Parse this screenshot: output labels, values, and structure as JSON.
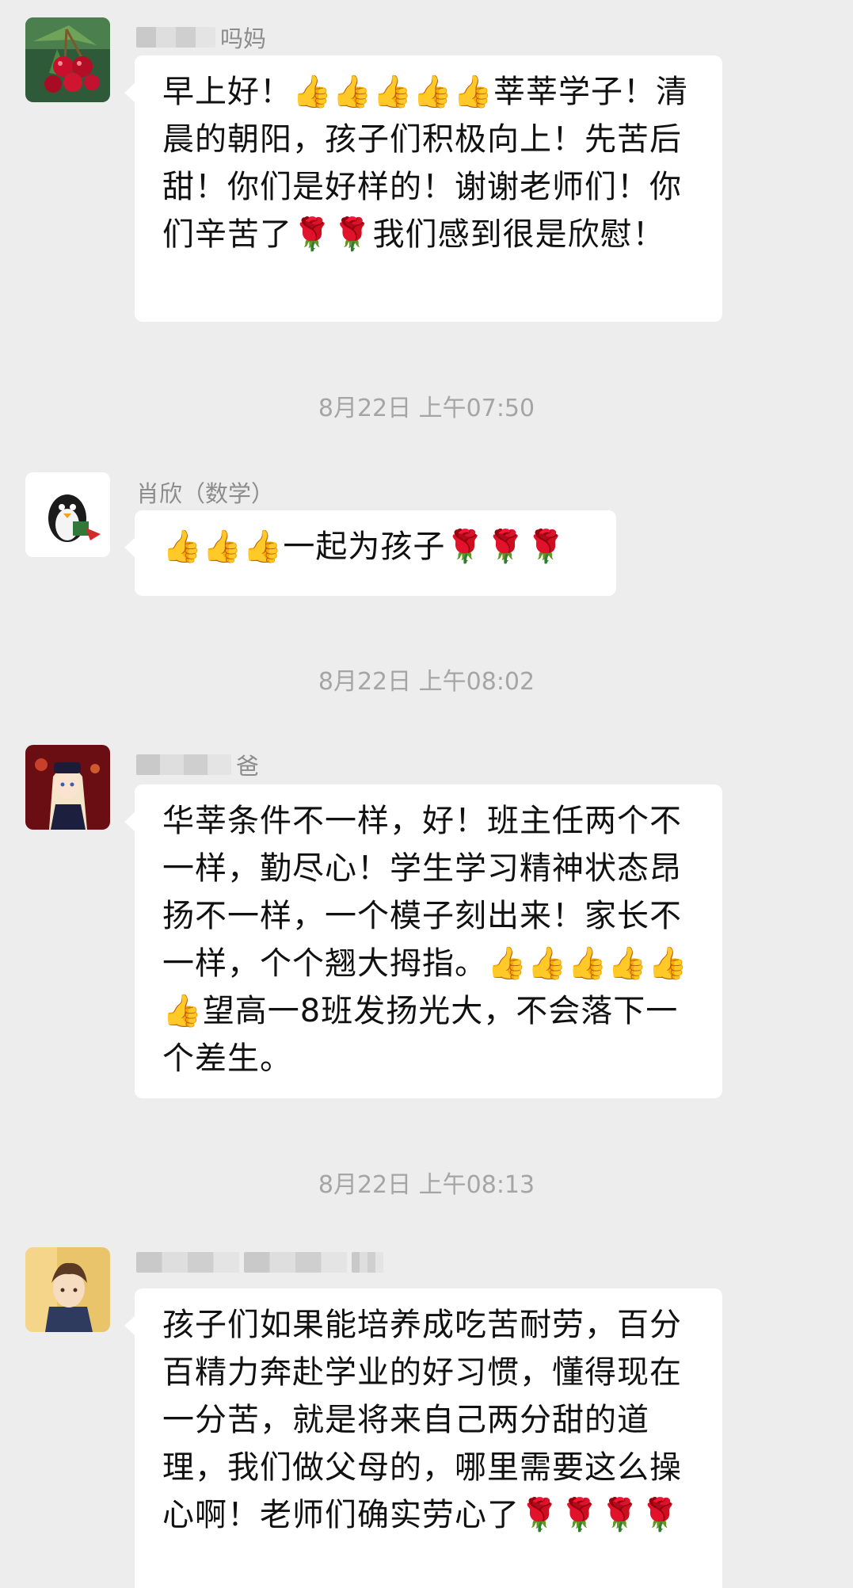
{
  "messages": [
    {
      "sender": "吗妈",
      "text": "早上好！👍👍👍👍👍莘莘学子！清晨的朝阳，孩子们积极向上！先苦后甜！你们是好样的！谢谢老师们！你们辛苦了🌹🌹我们感到很是欣慰！"
    },
    {
      "time": "8月22日 上午07:50",
      "sender": "肖欣（数学）",
      "text": "👍👍👍一起为孩子🌹🌹🌹"
    },
    {
      "time": "8月22日 上午08:02",
      "sender": "爸",
      "text": "华莘条件不一样，好！班主任两个不一样，勤尽心！学生学习精神状态昂扬不一样，一个模子刻出来！家长不一样，个个翘大拇指。👍👍👍👍👍👍望高一8班发扬光大，不会落下一个差生。"
    },
    {
      "time": "8月22日 上午08:13",
      "sender": "",
      "text": "孩子们如果能培养成吃苦耐劳，百分百精力奔赴学业的好习惯，懂得现在一分苦，就是将来自己两分甜的道理，我们做父母的，哪里需要这么操心啊！老师们确实劳心了🌹🌹🌹🌹"
    }
  ]
}
